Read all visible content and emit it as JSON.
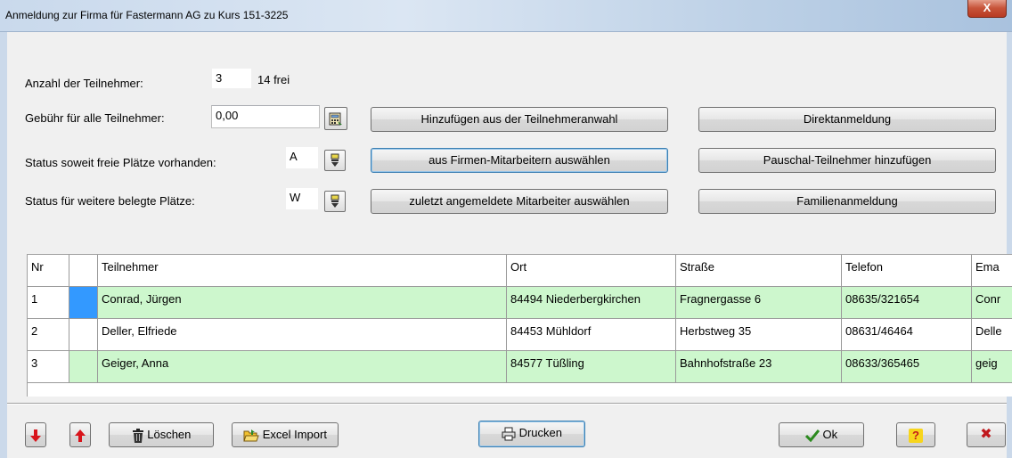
{
  "window": {
    "title": "Anmeldung zur Firma für Fastermann AG zu Kurs 151-3225",
    "close_glyph": "X"
  },
  "form": {
    "participants_label": "Anzahl der Teilnehmer:",
    "participants_value": "3",
    "free_text": "14 frei",
    "fee_label": "Gebühr für alle Teilnehmer:",
    "fee_value": "0,00",
    "status_free_label": "Status soweit freie Plätze vorhanden:",
    "status_free_value": "A",
    "status_booked_label": "Status für weitere belegte Plätze:",
    "status_booked_value": "W"
  },
  "buttons": {
    "add_from_selection": "Hinzufügen aus der Teilnehmeranwahl",
    "from_company_staff": "aus Firmen-Mitarbeitern auswählen",
    "last_registered_staff": "zuletzt angemeldete Mitarbeiter auswählen",
    "direct_registration": "Direktanmeldung",
    "add_flat_rate_participants": "Pauschal-Teilnehmer hinzufügen",
    "family_registration": "Familienanmeldung"
  },
  "table": {
    "columns": [
      "Nr",
      "",
      "Teilnehmer",
      "Ort",
      "Straße",
      "Telefon",
      "Ema"
    ],
    "rows": [
      {
        "nr": "1",
        "teilnehmer": "Conrad, Jürgen",
        "ort": "84494 Niederbergkirchen",
        "strasse": "Fragnergasse 6",
        "telefon": "08635/321654",
        "email": "Conr"
      },
      {
        "nr": "2",
        "teilnehmer": "Deller, Elfriede",
        "ort": "84453 Mühldorf",
        "strasse": "Herbstweg 35",
        "telefon": "08631/46464",
        "email": "Delle"
      },
      {
        "nr": "3",
        "teilnehmer": "Geiger, Anna",
        "ort": "84577 Tüßling",
        "strasse": "Bahnhofstraße 23",
        "telefon": "08633/365465",
        "email": "geig"
      }
    ]
  },
  "footer": {
    "delete_label": "Löschen",
    "excel_import_label": "Excel Import",
    "print_label": "Drucken",
    "ok_label": "Ok",
    "help_glyph": "?",
    "cancel_glyph": "✖"
  },
  "colors": {
    "row_green": "#cdf7cd",
    "selection_blue": "#3399ff",
    "arrow_red": "#d8141b"
  },
  "icons": [
    "calculator-icon",
    "dropdown-picker-icon",
    "arrow-down-icon",
    "arrow-up-icon",
    "trash-icon",
    "folder-open-icon",
    "printer-icon",
    "checkmark-icon",
    "help-icon",
    "cancel-icon"
  ]
}
